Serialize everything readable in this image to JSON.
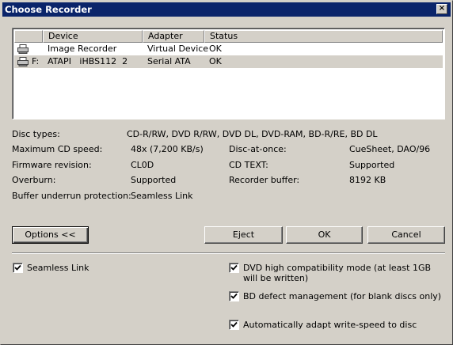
{
  "window": {
    "title": "Choose Recorder",
    "close_glyph": "×"
  },
  "device_list": {
    "columns": [
      "Device",
      "Adapter",
      "Status"
    ],
    "rows": [
      {
        "drive_letter": "",
        "device": "Image Recorder",
        "adapter": "Virtual Device",
        "status": "OK",
        "icon": "printer-recorder-icon",
        "selected": false
      },
      {
        "drive_letter": "F:",
        "device": "ATAPI   iHBS112  2",
        "adapter": "Serial ATA",
        "status": "OK",
        "icon": "drive-recorder-icon",
        "selected": true
      }
    ]
  },
  "info": {
    "disc_types_label": "Disc types:",
    "disc_types_value": "CD-R/RW, DVD R/RW, DVD DL, DVD-RAM, BD-R/RE, BD DL",
    "max_cd_speed_label": "Maximum CD speed:",
    "max_cd_speed_value": "48x (7,200 KB/s)",
    "firmware_label": "Firmware revision:",
    "firmware_value": "CL0D",
    "overburn_label": "Overburn:",
    "overburn_value": "Supported",
    "buffer_underrun_label": "Buffer underrun protection:",
    "buffer_underrun_value": "Seamless Link",
    "disc_at_once_label": "Disc-at-once:",
    "disc_at_once_value": "CueSheet, DAO/96",
    "cd_text_label": "CD TEXT:",
    "cd_text_value": "Supported",
    "recorder_buffer_label": "Recorder buffer:",
    "recorder_buffer_value": "8192 KB"
  },
  "buttons": {
    "options": "Options <<",
    "eject": "Eject",
    "ok": "OK",
    "cancel": "Cancel"
  },
  "options": {
    "seamless_link": {
      "label": "Seamless Link",
      "checked": true
    },
    "dvd_high_compat": {
      "label": "DVD high compatibility mode (at least 1GB will be written)",
      "checked": true
    },
    "bd_defect": {
      "label": "BD defect management (for blank discs only)",
      "checked": true
    },
    "auto_write_speed": {
      "label": "Automatically adapt write-speed to disc",
      "checked": true
    }
  },
  "colors": {
    "titlebar": "#0a246a",
    "face": "#d4d0c8",
    "list_background": "#ffffff"
  }
}
